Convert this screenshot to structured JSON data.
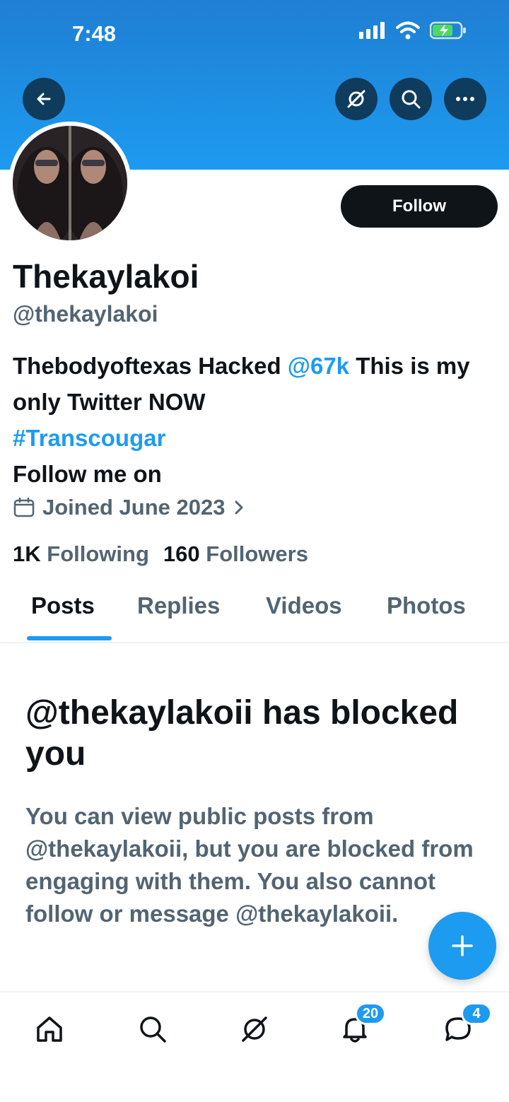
{
  "status_bar": {
    "time": "7:48"
  },
  "header": {
    "back_icon": "arrow-left-icon",
    "grok_icon": "grok-icon",
    "search_icon": "search-icon",
    "more_icon": "more-icon"
  },
  "profile": {
    "follow_label": "Follow",
    "display_name": "Thekaylakoi",
    "handle": "@thekaylakoi",
    "bio": {
      "part1": "Thebodyoftexas Hacked ",
      "mention": "@67k",
      "part2": " This is my only Twitter NOW",
      "hashtag": "#Transcougar",
      "part3": "Follow me on"
    },
    "joined": "Joined June 2023",
    "following_count": "1K",
    "following_label": "Following",
    "followers_count": "160",
    "followers_label": "Followers"
  },
  "tabs": [
    {
      "label": "Posts",
      "active": true
    },
    {
      "label": "Replies",
      "active": false
    },
    {
      "label": "Videos",
      "active": false
    },
    {
      "label": "Photos",
      "active": false
    }
  ],
  "blocked": {
    "title": "@thekaylakoii has blocked you",
    "description": "You can view public posts from @thekaylakoii, but you are blocked from engaging with them. You also cannot follow or message @thekaylakoii."
  },
  "fab_icon": "plus-icon",
  "bottom_nav": {
    "notifications_badge": "20",
    "messages_badge": "4"
  },
  "colors": {
    "accent": "#1d9bf0",
    "text": "#0f1419",
    "muted": "#536471"
  }
}
